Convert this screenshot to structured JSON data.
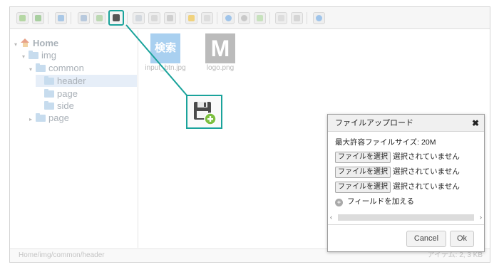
{
  "tree": {
    "home": "Home",
    "img": "img",
    "common": "common",
    "header": "header",
    "page_sub": "page",
    "side": "side",
    "page": "page"
  },
  "files": [
    {
      "name": "input_btn.jpg",
      "thumb_text": "検索"
    },
    {
      "name": "logo.png",
      "thumb_text": "M"
    }
  ],
  "statusbar": {
    "path": "Home/img/common/header",
    "count": "アイテム: 2, 3 KB"
  },
  "dialog": {
    "title": "ファイルアップロード",
    "close": "✖",
    "max_size": "最大許容ファイルサイズ: 20M",
    "choose_label": "ファイルを選択",
    "no_file": "選択されていません",
    "add_field": "フィールドを加える",
    "cancel": "Cancel",
    "ok": "Ok",
    "scroll_left": "‹",
    "scroll_right": "›"
  },
  "colors": {
    "highlight": "#1aa39b",
    "folder": "#c7dcee"
  }
}
